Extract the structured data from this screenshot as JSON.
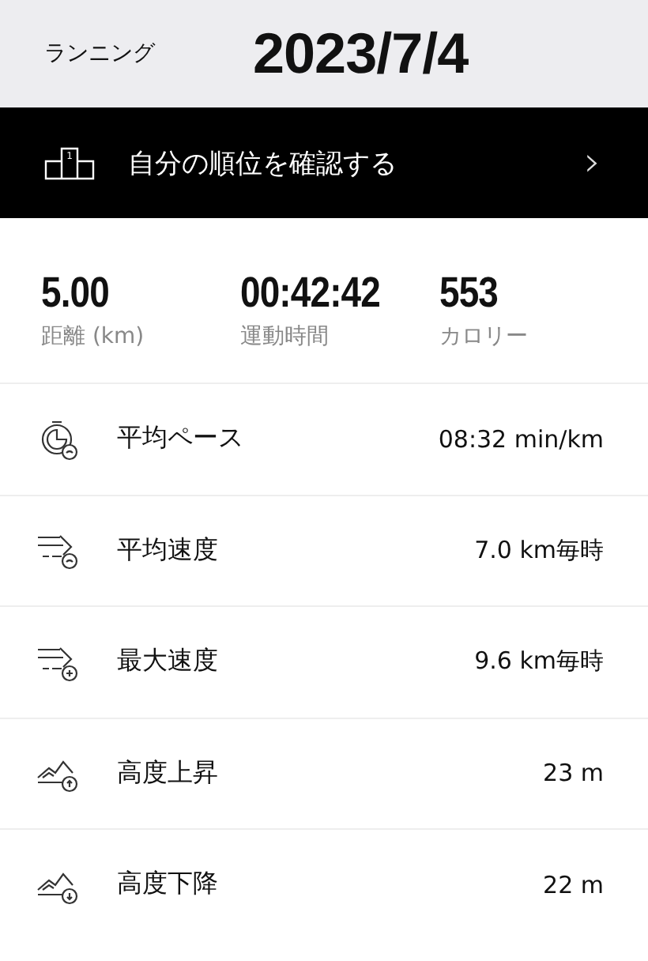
{
  "header": {
    "activity": "ランニング",
    "date": "2023/7/4"
  },
  "ranking_bar": {
    "label": "自分の順位を確認する",
    "rank_mark": "1",
    "chevron": "›"
  },
  "summary": [
    {
      "value": "5.00",
      "label": "距離 (km)"
    },
    {
      "value": "00:42:42",
      "label": "運動時間"
    },
    {
      "value": "553",
      "label": "カロリー"
    }
  ],
  "metrics": [
    {
      "kind": "pace",
      "label": "平均ペース",
      "value": "08:32 min/km"
    },
    {
      "kind": "avg-speed",
      "label": "平均速度",
      "value": "7.0 km毎時"
    },
    {
      "kind": "max-speed",
      "label": "最大速度",
      "value": "9.6 km毎時"
    },
    {
      "kind": "ascent",
      "label": "高度上昇",
      "value": "23 m"
    },
    {
      "kind": "descent",
      "label": "高度下降",
      "value": "22 m"
    }
  ]
}
